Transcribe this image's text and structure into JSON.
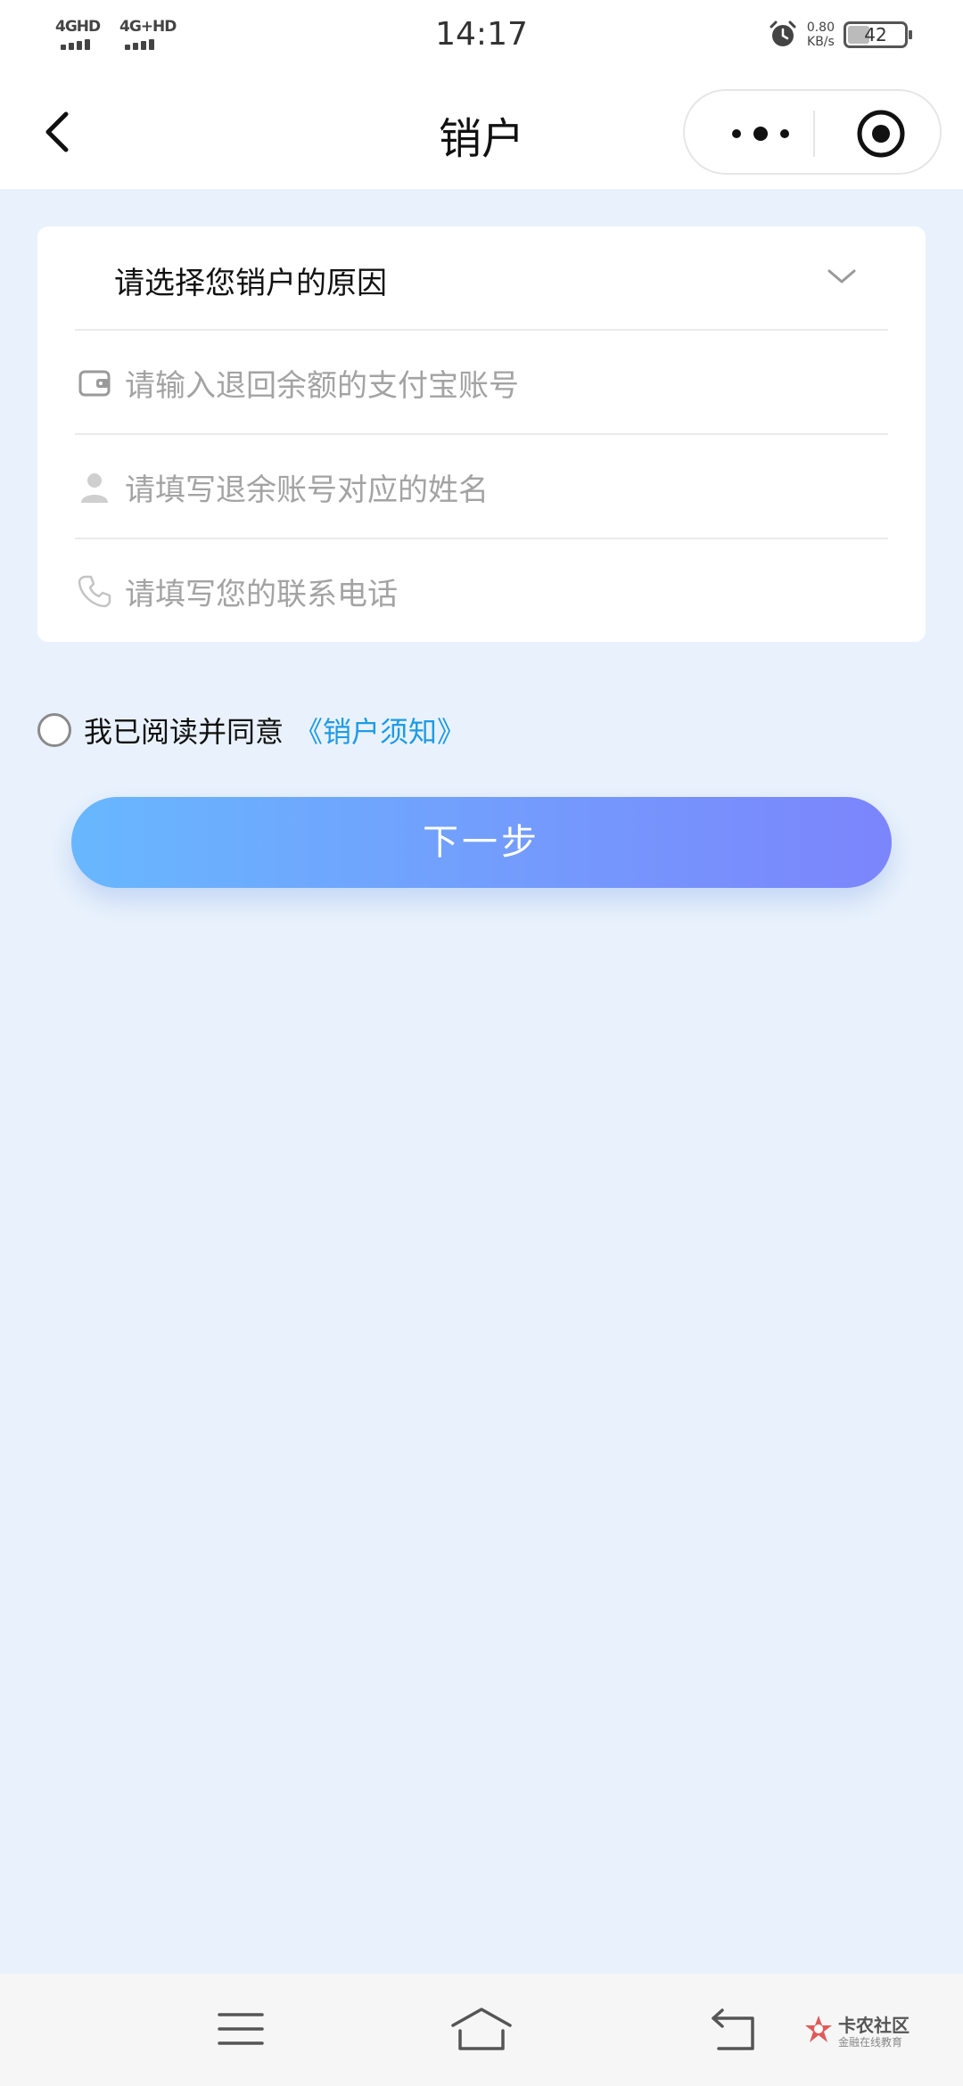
{
  "status_bar": {
    "network_1": "4GHD",
    "network_2": "4G+HD",
    "time": "14:17",
    "speed_value": "0.80",
    "speed_unit": "KB/s",
    "battery_level": "42",
    "battery_fraction": 0.42
  },
  "nav": {
    "title": "销户"
  },
  "form": {
    "reason_select": "请选择您销户的原因",
    "alipay_placeholder": "请输入退回余额的支付宝账号",
    "name_placeholder": "请填写退余账号对应的姓名",
    "phone_placeholder": "请填写您的联系电话"
  },
  "agreement": {
    "text": "我已阅读并同意",
    "link": "《销户须知》",
    "checked": false
  },
  "next_button": "下一步",
  "watermark": {
    "title": "卡农社区",
    "subtitle": "金融在线教育"
  },
  "colors": {
    "page_bg": "#e9f2fc",
    "link": "#1e9be6",
    "button_start": "#68b7fe",
    "button_end": "#7c85fc",
    "placeholder": "#a3a3a3"
  }
}
